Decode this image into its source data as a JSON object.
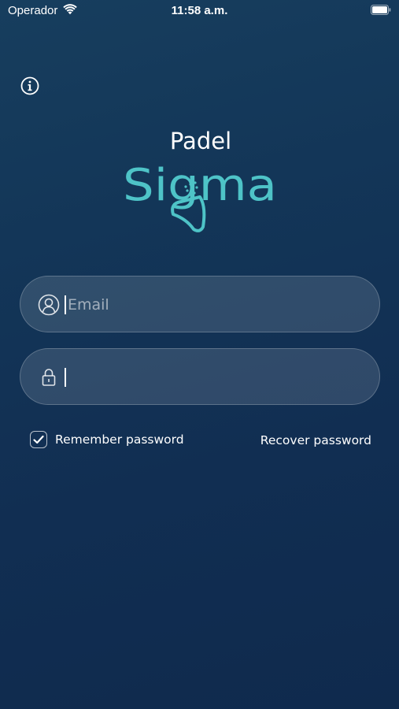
{
  "status_bar": {
    "carrier": "Operador",
    "time": "11:58 a.m."
  },
  "info_button": {
    "icon": "info-icon"
  },
  "logo": {
    "line1": "Padel",
    "line2": "Sigma",
    "accent_color": "#4ec3c7"
  },
  "form": {
    "email": {
      "placeholder": "Email",
      "value": "",
      "icon": "user-icon"
    },
    "password": {
      "placeholder": "",
      "value": "",
      "icon": "lock-icon"
    },
    "remember": {
      "label": "Remember password",
      "checked": true
    },
    "recover_label": "Recover password"
  },
  "colors": {
    "background_top": "#173e5e",
    "background_bottom": "#0f2a4d",
    "accent": "#4ec3c7"
  }
}
